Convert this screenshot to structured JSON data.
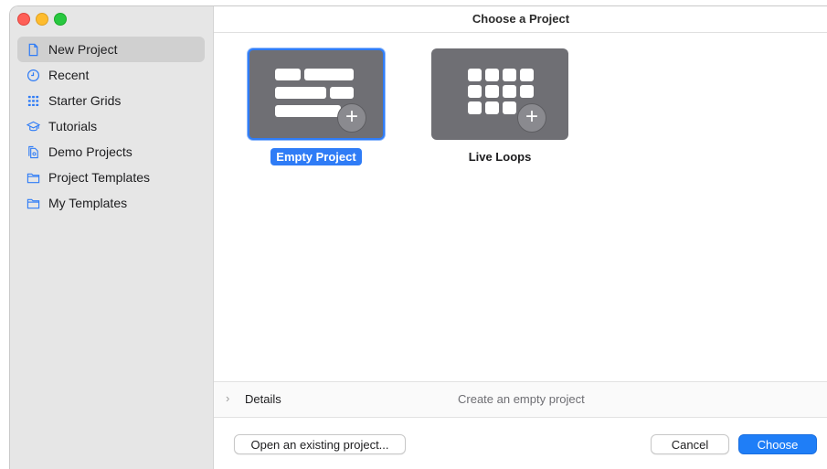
{
  "window": {
    "title": "Choose a Project"
  },
  "sidebar": {
    "items": [
      {
        "label": "New Project",
        "icon": "document-icon",
        "selected": true
      },
      {
        "label": "Recent",
        "icon": "clock-icon",
        "selected": false
      },
      {
        "label": "Starter Grids",
        "icon": "grid-icon",
        "selected": false
      },
      {
        "label": "Tutorials",
        "icon": "graduation-cap-icon",
        "selected": false
      },
      {
        "label": "Demo Projects",
        "icon": "documents-icon",
        "selected": false
      },
      {
        "label": "Project Templates",
        "icon": "folder-icon",
        "selected": false
      },
      {
        "label": "My Templates",
        "icon": "folder-icon",
        "selected": false
      }
    ]
  },
  "projects": [
    {
      "label": "Empty Project",
      "selected": true
    },
    {
      "label": "Live Loops",
      "selected": false
    }
  ],
  "details": {
    "label": "Details",
    "description": "Create an empty project"
  },
  "footer": {
    "open_label": "Open an existing project...",
    "cancel_label": "Cancel",
    "choose_label": "Choose"
  },
  "colors": {
    "accent": "#2f7cf6",
    "tile": "#6f6f74"
  }
}
